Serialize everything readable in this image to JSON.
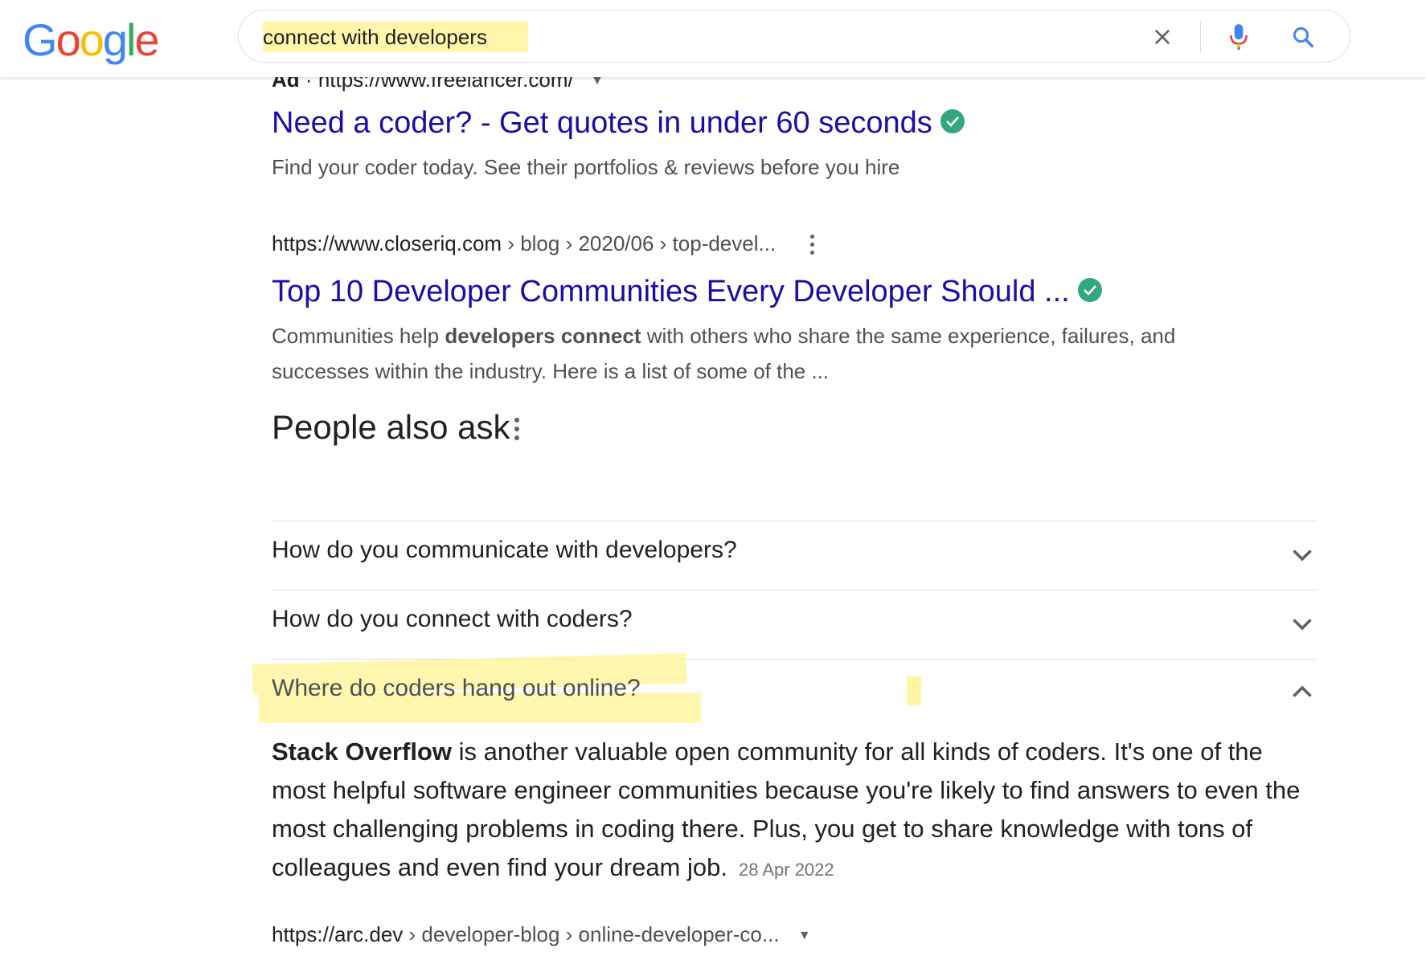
{
  "search": {
    "query": "connect with developers",
    "clear_label": "Clear",
    "voice_label": "Search by voice",
    "submit_label": "Search"
  },
  "logo": {
    "text": "Google"
  },
  "ad_result": {
    "ad_label": "Ad",
    "separator": "·",
    "url": "https://www.freelancer.com/",
    "title": "Need a coder? - Get quotes in under 60 seconds",
    "snippet": "Find your coder today. See their portfolios & reviews before you hire"
  },
  "result1": {
    "url_domain": "https://www.closeriq.com",
    "url_path": " › blog › 2020/06 › top-devel...",
    "title": "Top 10 Developer Communities Every Developer Should ...",
    "snippet_pre": "Communities help ",
    "snippet_bold": "developers connect",
    "snippet_post": " with others who share the same experience, failures, and successes within the industry. Here is a list of some of the ..."
  },
  "people_also_ask": {
    "title": "People also ask",
    "questions": [
      {
        "text": "How do you communicate with developers?",
        "expanded": false
      },
      {
        "text": "How do you connect with coders?",
        "expanded": false
      },
      {
        "text": "Where do coders hang out online?",
        "expanded": true
      }
    ],
    "answer": {
      "bold": "Stack Overflow",
      "text": " is another valuable open community for all kinds of coders. It's one of the most helpful software engineer communities because you're likely to find answers to even the most challenging problems in coding there. Plus, you get to share knowledge with tons of colleagues and even find your dream job.",
      "date": "28 Apr 2022"
    }
  },
  "result2": {
    "url_domain": "https://arc.dev",
    "url_path": " › developer-blog › online-developer-co..."
  },
  "colors": {
    "link": "#1a0dab",
    "verified": "#34a77f",
    "highlight": "#fff59a"
  }
}
